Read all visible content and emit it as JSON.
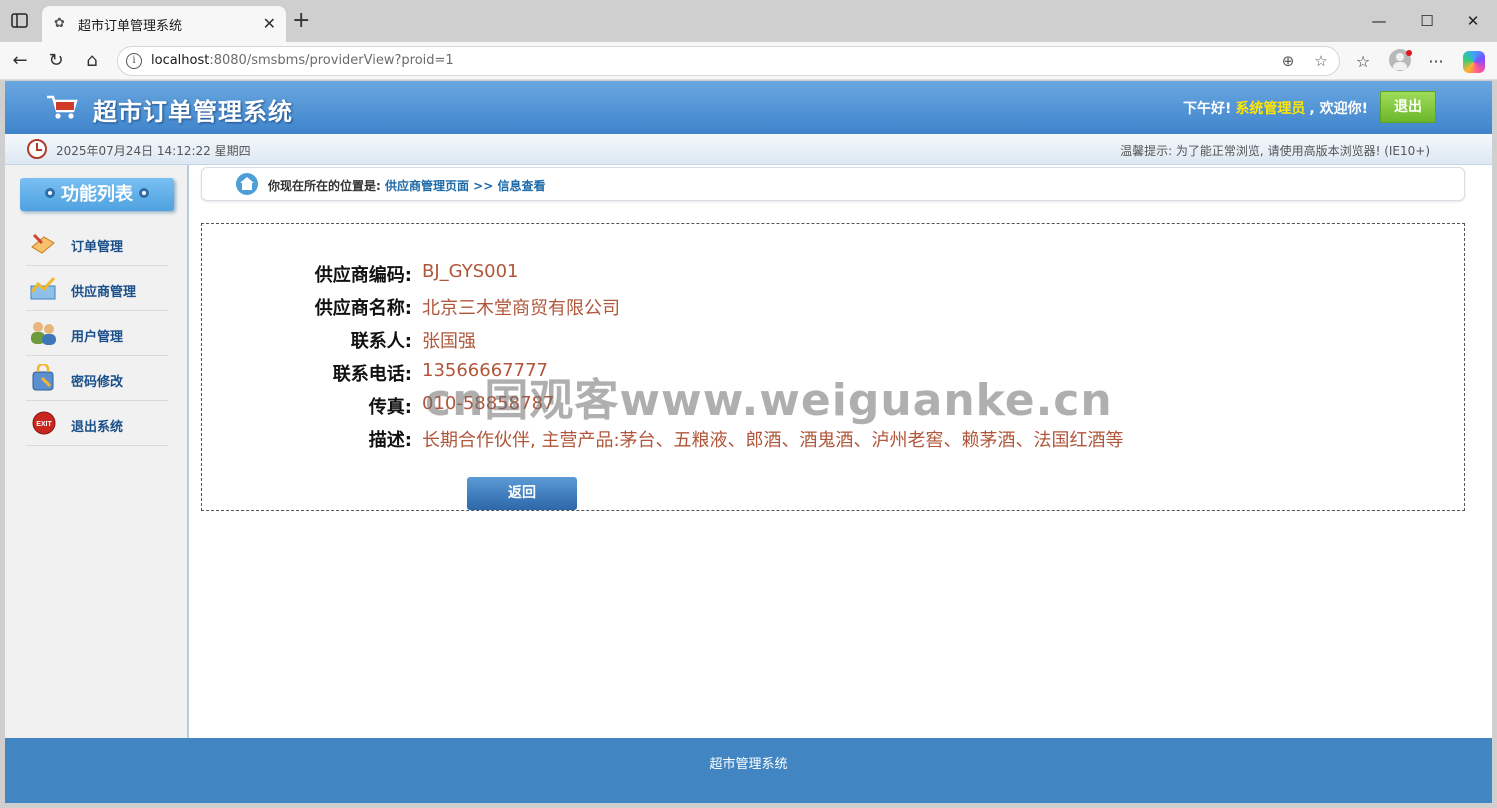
{
  "browser": {
    "tab_title": "超市订单管理系统",
    "url_host": "localhost",
    "url_rest": ":8080/smsbms/providerView?proid=1"
  },
  "header": {
    "app_title": "超市订单管理系统",
    "greeting": "下午好!",
    "username": "系统管理员",
    "welcome": ", 欢迎你!",
    "logout_label": "退出"
  },
  "subbar": {
    "datetime": "2025年07月24日 14:12:22 星期四",
    "tip": "温馨提示: 为了能正常浏览, 请使用高版本浏览器! (IE10+)"
  },
  "sidebar": {
    "title": "功能列表",
    "items": [
      {
        "label": "订单管理",
        "icon": "order-icon"
      },
      {
        "label": "供应商管理",
        "icon": "provider-icon"
      },
      {
        "label": "用户管理",
        "icon": "users-icon"
      },
      {
        "label": "密码修改",
        "icon": "password-icon"
      },
      {
        "label": "退出系统",
        "icon": "exit-icon"
      }
    ]
  },
  "breadcrumb": {
    "prefix": "你现在所在的位置是:",
    "path": "供应商管理页面 >> 信息查看"
  },
  "provider": {
    "code_label": "供应商编码:",
    "code": "BJ_GYS001",
    "name_label": "供应商名称:",
    "name": "北京三木堂商贸有限公司",
    "contact_label": "联系人:",
    "contact": "张国强",
    "phone_label": "联系电话:",
    "phone": "13566667777",
    "fax_label": "传真:",
    "fax": "010-58858787",
    "desc_label": "描述:",
    "desc": "长期合作伙伴, 主营产品:茅台、五粮液、郎酒、酒鬼酒、泸州老窖、赖茅酒、法国红酒等",
    "back_label": "返回"
  },
  "watermark": "cn国观客www.weiguanke.cn",
  "footer": {
    "text": "超市管理系统"
  },
  "colors": {
    "header_blue": "#3f84cc",
    "value_red": "#b0563a",
    "logout_green": "#6bb72a",
    "footer_blue": "#4186c3"
  }
}
